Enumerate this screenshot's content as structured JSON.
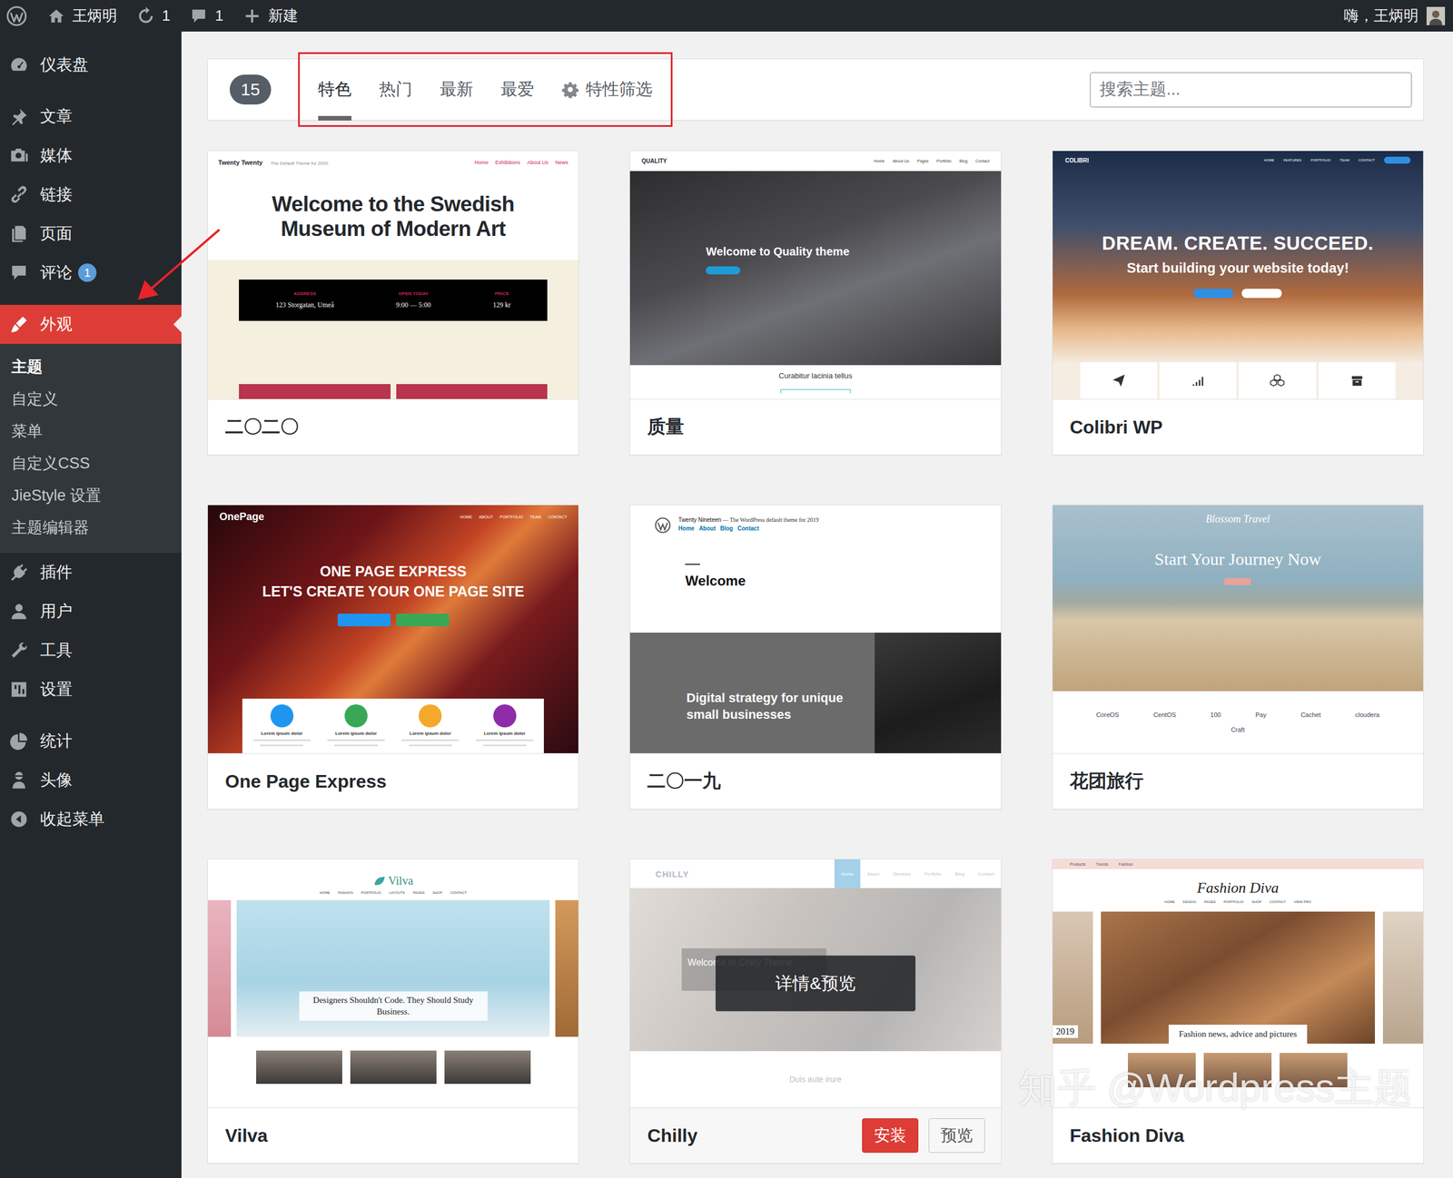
{
  "admin_bar": {
    "site_name": "王炳明",
    "updates": "1",
    "comments": "1",
    "new_label": "新建",
    "greeting": "嗨，王炳明"
  },
  "sidebar": {
    "items": [
      {
        "label": "仪表盘",
        "selected": false
      },
      {
        "label": "文章",
        "selected": false
      },
      {
        "label": "媒体",
        "selected": false
      },
      {
        "label": "链接",
        "selected": false
      },
      {
        "label": "页面",
        "selected": false
      },
      {
        "label": "评论",
        "selected": false,
        "badge": "1"
      },
      {
        "label": "外观",
        "selected": true,
        "submenu": [
          {
            "label": "主题",
            "selected": true
          },
          {
            "label": "自定义",
            "selected": false
          },
          {
            "label": "菜单",
            "selected": false
          },
          {
            "label": "自定义CSS",
            "selected": false
          },
          {
            "label": "JieStyle 设置",
            "selected": false
          },
          {
            "label": "主题编辑器",
            "selected": false
          }
        ]
      },
      {
        "label": "插件",
        "selected": false
      },
      {
        "label": "用户",
        "selected": false
      },
      {
        "label": "工具",
        "selected": false
      },
      {
        "label": "设置",
        "selected": false
      },
      {
        "label": "统计",
        "selected": false
      },
      {
        "label": "头像",
        "selected": false
      },
      {
        "label": "收起菜单",
        "selected": false
      }
    ]
  },
  "filter_bar": {
    "count": "15",
    "tabs": [
      {
        "label": "特色",
        "selected": true,
        "kind": "tab"
      },
      {
        "label": "热门",
        "selected": false,
        "kind": "tab"
      },
      {
        "label": "最新",
        "selected": false,
        "kind": "tab"
      },
      {
        "label": "最爱",
        "selected": false,
        "kind": "tab"
      },
      {
        "label": "特性筛选",
        "selected": false,
        "kind": "filter"
      }
    ],
    "search": {
      "placeholder": "搜索主题..."
    }
  },
  "themes": {
    "hover_label": "详情&预览",
    "actions": [
      "安装",
      "预览"
    ],
    "cards": [
      {
        "name": "二〇二〇",
        "hovered": false,
        "preview": {
          "kind": "museum",
          "brand": "Twenty Twenty",
          "tagline": "The Default Theme for 2020",
          "nav": [
            "Home",
            "Exhibitions",
            "About Us",
            "News"
          ],
          "headline": "Welcome to the Swedish Museum of Modern Art",
          "facts": [
            {
              "label": "ADDRESS",
              "value": "123 Storgatan, Umeå"
            },
            {
              "label": "OPEN TODAY",
              "value": "9:00 — 5:00"
            },
            {
              "label": "PRICE",
              "value": "129 kr"
            }
          ]
        }
      },
      {
        "name": "质量",
        "hovered": false,
        "preview": {
          "kind": "office",
          "brand": "QUALITY",
          "nav": [
            "Home",
            "About Us",
            "Pages",
            "Portfolio",
            "Blog",
            "Contact"
          ],
          "headline": "Welcome to Quality theme",
          "footer": "Curabitur lacinia tellus"
        }
      },
      {
        "name": "Colibri WP",
        "hovered": false,
        "preview": {
          "kind": "clouds",
          "brand": "COLIBRI",
          "nav": [
            "HOME",
            "FEATURES",
            "PORTFOLIO",
            "TEAM",
            "CONTACT"
          ],
          "headline": "DREAM. CREATE. SUCCEED.",
          "subline": "Start building your website today!"
        }
      },
      {
        "name": "One Page Express",
        "hovered": false,
        "preview": {
          "kind": "canyon",
          "brand": "OnePage",
          "nav": [
            "HOME",
            "ABOUT",
            "PORTFOLIO",
            "TEAM",
            "CONTACT"
          ],
          "headline": "ONE PAGE EXPRESS",
          "subline": "LET'S CREATE YOUR ONE PAGE SITE",
          "features": [
            {
              "label": "Lorem ipsum dolor",
              "color": "#1e96f0"
            },
            {
              "label": "Lorem ipsum dolor",
              "color": "#3aa757"
            },
            {
              "label": "Lorem ipsum dolor",
              "color": "#f4a92a"
            },
            {
              "label": "Lorem ipsum dolor",
              "color": "#8e2ba8"
            }
          ]
        }
      },
      {
        "name": "二〇一九",
        "hovered": false,
        "preview": {
          "kind": "strategy",
          "brand": "Twenty Nineteen",
          "tagline": "— The WordPress default theme for 2019",
          "nav": [
            "Home",
            "About",
            "Blog",
            "Contact"
          ],
          "headline": "Welcome",
          "subline": "Digital strategy for unique small businesses"
        }
      },
      {
        "name": "花团旅行",
        "hovered": false,
        "preview": {
          "kind": "beach",
          "brand": "Blossom Travel",
          "headline": "Start Your Journey Now",
          "logos": [
            "CoreOS",
            "CentOS",
            "100",
            "Pay",
            "Cachet",
            "cloudera",
            "Craft"
          ]
        }
      },
      {
        "name": "Vilva",
        "hovered": false,
        "preview": {
          "kind": "cycle",
          "brand": "Vilva",
          "nav": [
            "HOME",
            "FASHION",
            "PORTFOLIO",
            "LAYOUTS",
            "PAGES",
            "SHOP",
            "CONTACT"
          ],
          "headline": "Designers Shouldn't Code. They Should Study Business."
        }
      },
      {
        "name": "Chilly",
        "hovered": true,
        "preview": {
          "kind": "chilly",
          "brand": "CHILLY",
          "nav": [
            {
              "label": "Home",
              "selected": true
            },
            {
              "label": "About",
              "selected": false
            },
            {
              "label": "Services",
              "selected": false
            },
            {
              "label": "Portfolio",
              "selected": false
            },
            {
              "label": "Blog",
              "selected": false
            },
            {
              "label": "Contact",
              "selected": false
            }
          ],
          "headline": "Welcome to Chilly Theme",
          "footer": "Duis aute irure"
        }
      },
      {
        "name": "Fashion Diva",
        "hovered": false,
        "preview": {
          "kind": "fashion",
          "brand": "Fashion Diva",
          "topnav": [
            "Products",
            "Trends",
            "Fashion"
          ],
          "nav": [
            "HOME",
            "DESIGN",
            "PAGES",
            "PORTFOLIO",
            "SHOP",
            "CONTACT",
            "VIEW PRO"
          ],
          "headline": "Fashion news, advice and pictures",
          "aside": "2019"
        }
      }
    ]
  },
  "watermark": "知乎 @Wordpress主题"
}
